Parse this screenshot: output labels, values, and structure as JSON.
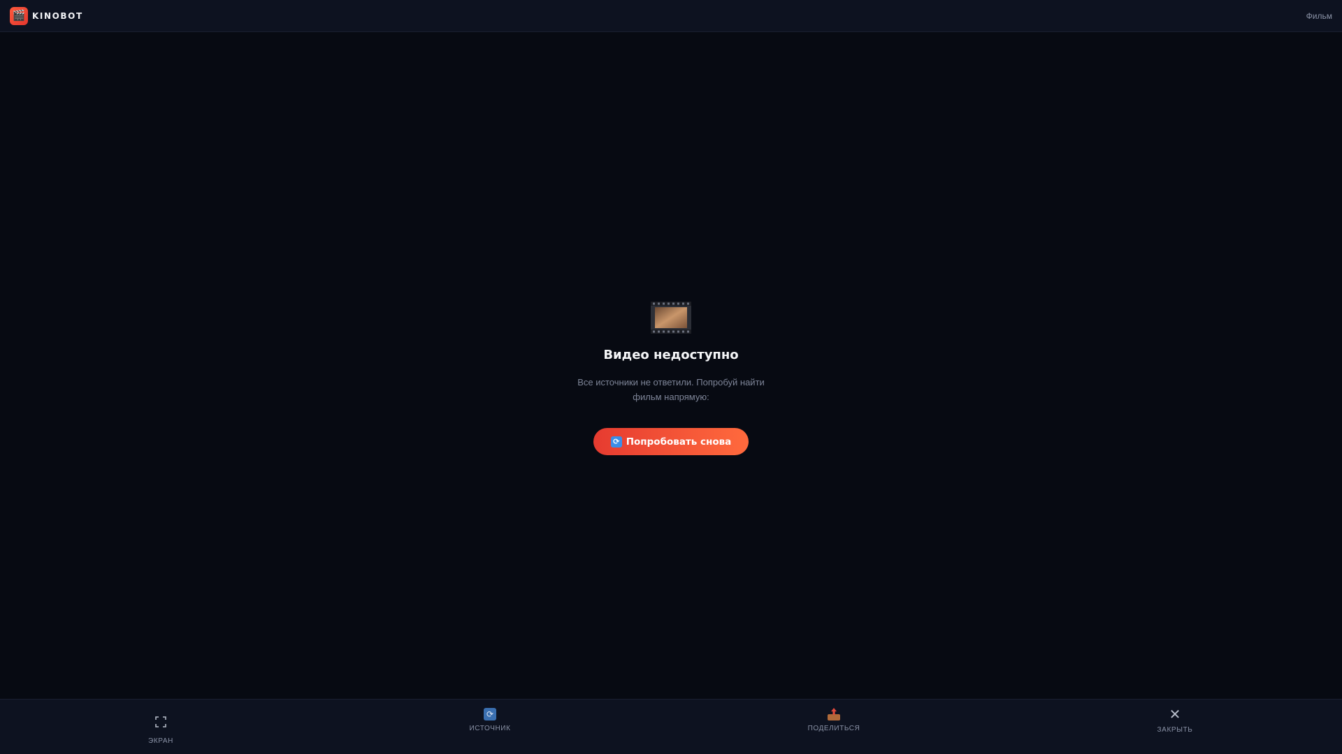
{
  "header": {
    "brand_name": "KINOBOT",
    "logo_icon": "clapperboard-icon",
    "nav_link": "Фильм"
  },
  "error": {
    "icon": "film-strip-icon",
    "title": "Видео недоступно",
    "description": "Все источники не ответили. Попробуй найти фильм напрямую:",
    "retry_label": "Попробовать снова",
    "retry_icon": "refresh-icon"
  },
  "bottom_bar": {
    "items": [
      {
        "label": "ЭКРАН",
        "icon": "fullscreen-icon"
      },
      {
        "label": "ИСТОЧНИК",
        "icon": "refresh-icon"
      },
      {
        "label": "ПОДЕЛИТЬСЯ",
        "icon": "outbox-tray-icon"
      },
      {
        "label": "ЗАКРЫТЬ",
        "icon": "close-icon"
      }
    ]
  },
  "colors": {
    "background": "#070a12",
    "panel": "#0d1220",
    "accent_start": "#e63b30",
    "accent_end": "#ff6a3d"
  }
}
